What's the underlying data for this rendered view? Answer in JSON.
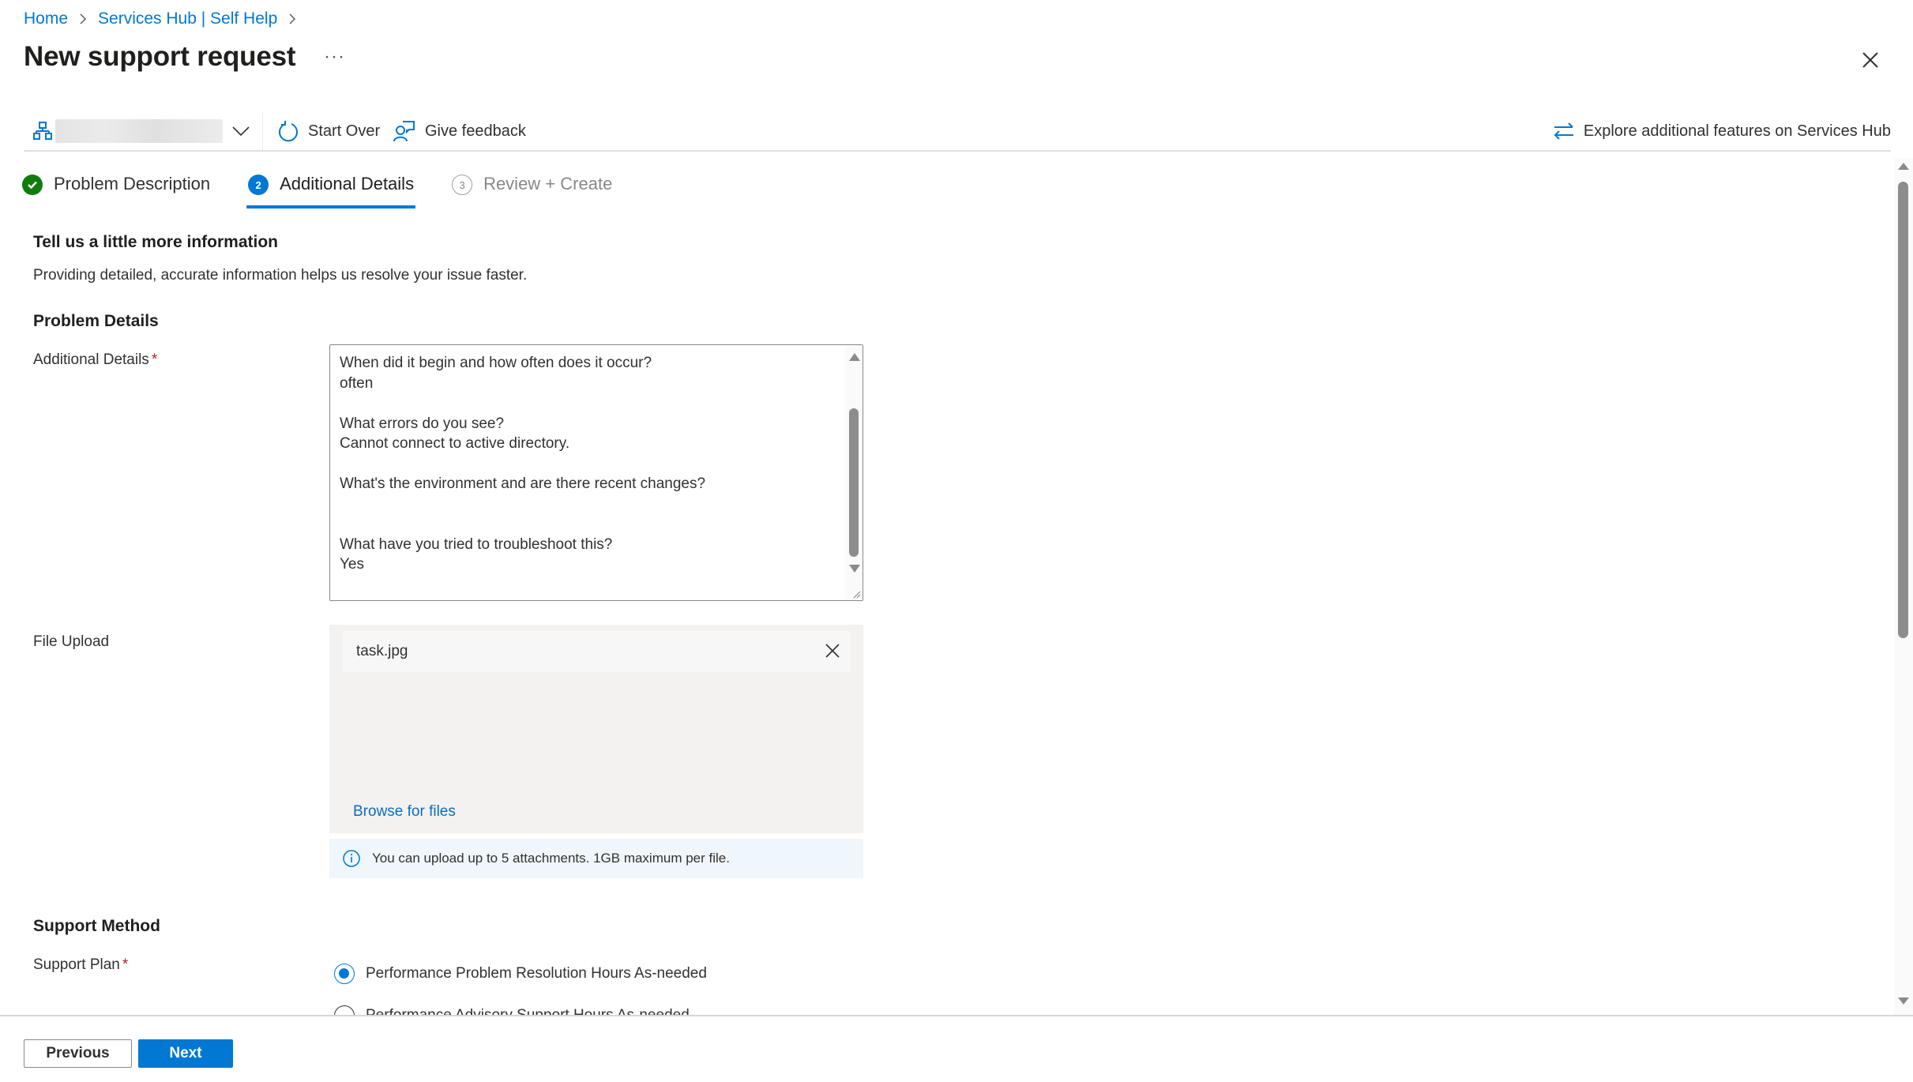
{
  "breadcrumb": {
    "items": [
      "Home",
      "Services Hub | Self Help"
    ]
  },
  "header": {
    "title": "New support request",
    "more_label": "···"
  },
  "toolbar": {
    "scope_value": "",
    "start_over_label": "Start Over",
    "give_feedback_label": "Give feedback",
    "explore_label": "Explore additional features on Services Hub"
  },
  "steps": [
    {
      "number": "1",
      "label": "Problem Description",
      "state": "done"
    },
    {
      "number": "2",
      "label": "Additional Details",
      "state": "active"
    },
    {
      "number": "3",
      "label": "Review + Create",
      "state": "pending"
    }
  ],
  "intro": {
    "heading": "Tell us a little more information",
    "description": "Providing detailed, accurate information helps us resolve your issue faster."
  },
  "problem_details": {
    "heading": "Problem Details",
    "additional_details_label": "Additional Details",
    "required_marker": "*",
    "additional_details_value": "When did it begin and how often does it occur?\noften\n\nWhat errors do you see?\nCannot connect to active directory.\n\nWhat's the environment and are there recent changes?\n\n\nWhat have you tried to troubleshoot this?\nYes",
    "file_upload_label": "File Upload",
    "files": [
      {
        "name": "task.jpg"
      }
    ],
    "browse_label": "Browse for files",
    "upload_info": "You can upload up to 5 attachments. 1GB maximum per file."
  },
  "support_method": {
    "heading": "Support Method",
    "support_plan_label": "Support Plan",
    "required_marker": "*",
    "options": [
      {
        "label": "Performance Problem Resolution Hours As-needed",
        "checked": true
      },
      {
        "label": "Performance Advisory Support Hours As-needed",
        "checked": false
      }
    ]
  },
  "footer": {
    "previous_label": "Previous",
    "next_label": "Next"
  },
  "colors": {
    "accent": "#0078d4",
    "success": "#107c10",
    "required": "#a4262c",
    "info_background": "#eff6fc"
  }
}
